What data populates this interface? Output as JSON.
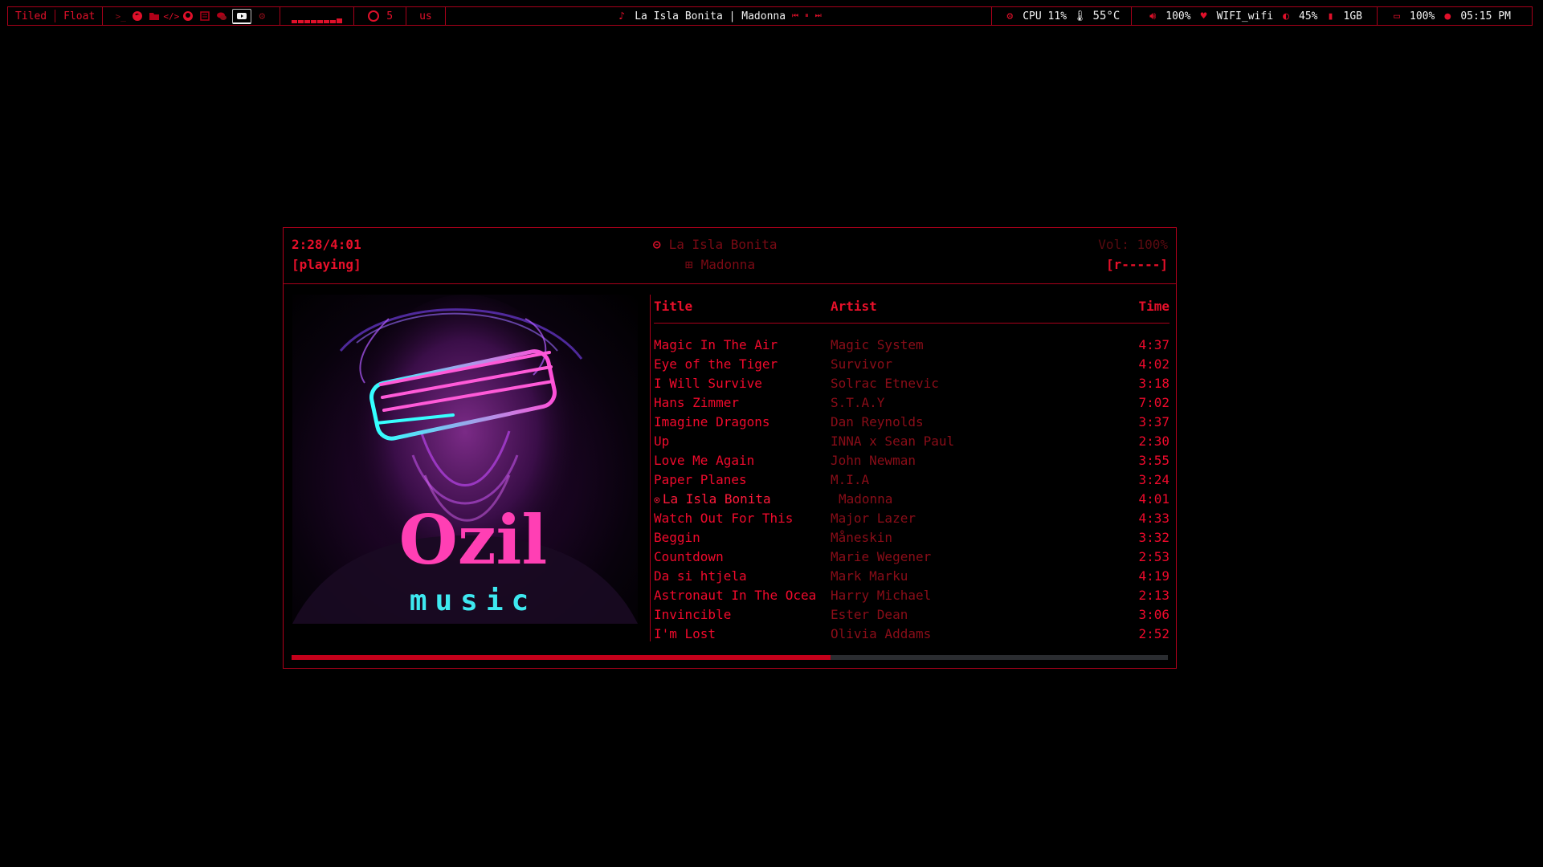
{
  "topbar": {
    "layouts": [
      "Tiled",
      "Float"
    ],
    "github_count": "5",
    "keyboard": "us",
    "now_playing": "La Isla Bonita | Madonna",
    "cpu": "CPU 11%",
    "temp": "55°C",
    "volume": "100%",
    "wifi": "WIFI_wifi",
    "brightness": "45%",
    "memory": "1GB",
    "battery": "100%",
    "clock": "05:15 PM",
    "workspace_icons": [
      "terminal-icon",
      "firefox-icon",
      "folder-icon",
      "code-icon",
      "github-icon",
      "notes-icon",
      "chat-icon",
      "media-icon",
      "settings-icon"
    ]
  },
  "player": {
    "elapsed": "2:28/4:01",
    "state": "[playing]",
    "song": "La Isla Bonita",
    "artist": "Madonna",
    "volume": "Vol: 100%",
    "mode": "[r-----]",
    "progress": 0.615,
    "cover": {
      "line1": "Ozil",
      "line2": "music"
    },
    "columns": {
      "title": "Title",
      "artist": "Artist",
      "time": "Time"
    },
    "current_index": 8,
    "playlist": [
      {
        "title": "Magic In The Air",
        "artist": "Magic System",
        "time": "4:37"
      },
      {
        "title": "Eye of the Tiger",
        "artist": "Survivor",
        "time": "4:02"
      },
      {
        "title": "I Will Survive",
        "artist": "Solrac Etnevic",
        "time": "3:18"
      },
      {
        "title": "Hans Zimmer",
        "artist": "S.T.A.Y",
        "time": "7:02"
      },
      {
        "title": "Imagine Dragons",
        "artist": "Dan Reynolds",
        "time": "3:37"
      },
      {
        "title": "Up",
        "artist": "INNA x Sean Paul",
        "time": "2:30"
      },
      {
        "title": "Love Me Again",
        "artist": "John Newman",
        "time": "3:55"
      },
      {
        "title": "Paper Planes",
        "artist": "M.I.A",
        "time": "3:24"
      },
      {
        "title": "La Isla Bonita",
        "artist": "Madonna",
        "time": "4:01"
      },
      {
        "title": "Watch Out For This",
        "artist": "Major Lazer",
        "time": "4:33"
      },
      {
        "title": "Beggin",
        "artist": "Måneskin",
        "time": "3:32"
      },
      {
        "title": "Countdown",
        "artist": "Marie Wegener",
        "time": "2:53"
      },
      {
        "title": "Da si htjela",
        "artist": "Mark Marku",
        "time": "4:19"
      },
      {
        "title": "Astronaut In The Ocea",
        "artist": "Harry Michael",
        "time": "2:13"
      },
      {
        "title": "Invincible",
        "artist": "Ester Dean",
        "time": "3:06"
      },
      {
        "title": "I'm Lost",
        "artist": "Olivia Addams",
        "time": "2:52"
      }
    ]
  },
  "colors": {
    "accent": "#e0102a",
    "dim": "#8a0d18",
    "background": "#000000"
  }
}
